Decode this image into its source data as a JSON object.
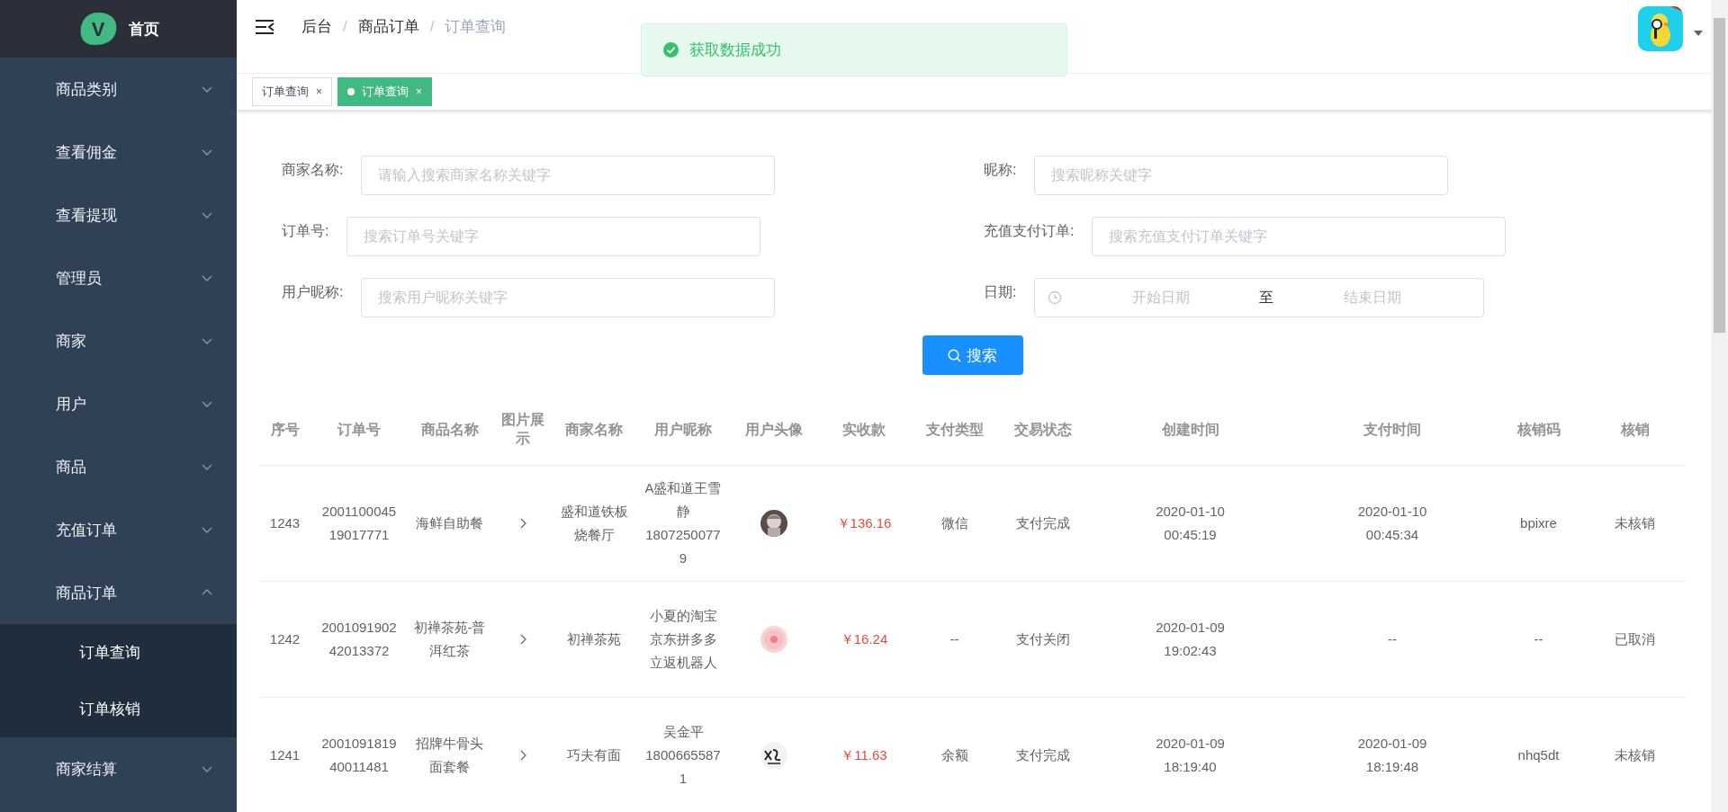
{
  "logo": {
    "letter": "V",
    "title": "首页"
  },
  "sidebar": {
    "items": [
      {
        "label": "商品类别",
        "expanded": false
      },
      {
        "label": "查看佣金",
        "expanded": false
      },
      {
        "label": "查看提现",
        "expanded": false
      },
      {
        "label": "管理员",
        "expanded": false
      },
      {
        "label": "商家",
        "expanded": false
      },
      {
        "label": "用户",
        "expanded": false
      },
      {
        "label": "商品",
        "expanded": false
      },
      {
        "label": "充值订单",
        "expanded": false
      },
      {
        "label": "商品订单",
        "expanded": true,
        "children": [
          {
            "label": "订单查询"
          },
          {
            "label": "订单核销"
          }
        ]
      },
      {
        "label": "商家结算",
        "expanded": false
      }
    ]
  },
  "breadcrumb": {
    "separator": "/",
    "items": [
      "后台",
      "商品订单",
      "订单查询"
    ]
  },
  "toast": {
    "message": "获取数据成功"
  },
  "tabs": [
    {
      "label": "订单查询",
      "selected": false,
      "close": "×"
    },
    {
      "label": "订单查询",
      "selected": true,
      "close": "×"
    }
  ],
  "form": {
    "fields": [
      {
        "label": "商家名称:",
        "placeholder": "请输入搜索商家名称关键字"
      },
      {
        "label": "昵称:",
        "placeholder": "搜索昵称关键字"
      },
      {
        "label": "订单号:",
        "placeholder": "搜索订单号关键字"
      },
      {
        "label": "充值支付订单:",
        "placeholder": "搜索充值支付订单关键字"
      },
      {
        "label": "用户昵称:",
        "placeholder": "搜索用户昵称关键字"
      }
    ],
    "date": {
      "label": "日期:",
      "start_placeholder": "开始日期",
      "separator": "至",
      "end_placeholder": "结束日期"
    },
    "search_button": "搜索"
  },
  "table": {
    "columns": [
      "序号",
      "订单号",
      "商品名称",
      "图片展示",
      "商家名称",
      "用户昵称",
      "用户头像",
      "实收款",
      "支付类型",
      "交易状态",
      "创建时间",
      "支付时间",
      "核销码",
      "核销"
    ],
    "rows": [
      {
        "cells": [
          {
            "kind": "text",
            "text": "1243"
          },
          {
            "kind": "text",
            "text": "200110004519017771"
          },
          {
            "kind": "text",
            "text": "海鲜自助餐"
          },
          {
            "kind": "expand"
          },
          {
            "kind": "text",
            "text": "盛和道铁板烧餐厅"
          },
          {
            "kind": "text",
            "text": "A盛和道王雪静18072500779"
          },
          {
            "kind": "avatar"
          },
          {
            "kind": "amount",
            "text": "￥136.16"
          },
          {
            "kind": "text",
            "text": "微信"
          },
          {
            "kind": "text",
            "text": "支付完成"
          },
          {
            "kind": "text",
            "text": "2020-01-10 00:45:19"
          },
          {
            "kind": "text",
            "text": "2020-01-10 00:45:34"
          },
          {
            "kind": "text",
            "text": "bpixre"
          },
          {
            "kind": "text",
            "text": "未核销"
          }
        ]
      },
      {
        "cells": [
          {
            "kind": "text",
            "text": "1242"
          },
          {
            "kind": "text",
            "text": "200109190242013372"
          },
          {
            "kind": "text",
            "text": "初禅茶苑-普洱红茶"
          },
          {
            "kind": "expand"
          },
          {
            "kind": "text",
            "text": "初禅茶苑"
          },
          {
            "kind": "text",
            "text": "小夏的淘宝京东拼多多立返机器人"
          },
          {
            "kind": "avatar"
          },
          {
            "kind": "amount",
            "text": "￥16.24"
          },
          {
            "kind": "text",
            "text": "--"
          },
          {
            "kind": "text",
            "text": "支付关闭"
          },
          {
            "kind": "text",
            "text": "2020-01-09 19:02:43"
          },
          {
            "kind": "text",
            "text": "--"
          },
          {
            "kind": "text",
            "text": "--"
          },
          {
            "kind": "text",
            "text": "已取消"
          }
        ]
      },
      {
        "cells": [
          {
            "kind": "text",
            "text": "1241"
          },
          {
            "kind": "text",
            "text": "200109181940011481"
          },
          {
            "kind": "text",
            "text": "招牌牛骨头面套餐"
          },
          {
            "kind": "expand"
          },
          {
            "kind": "text",
            "text": "巧夫有面"
          },
          {
            "kind": "text",
            "text": "吴金平18006655871"
          },
          {
            "kind": "avatar"
          },
          {
            "kind": "amount",
            "text": "￥11.63"
          },
          {
            "kind": "text",
            "text": "余额"
          },
          {
            "kind": "text",
            "text": "支付完成"
          },
          {
            "kind": "text",
            "text": "2020-01-09 18:19:40"
          },
          {
            "kind": "text",
            "text": "2020-01-09 18:19:48"
          },
          {
            "kind": "text",
            "text": "nhq5dt"
          },
          {
            "kind": "text",
            "text": "未核销"
          }
        ]
      }
    ]
  }
}
